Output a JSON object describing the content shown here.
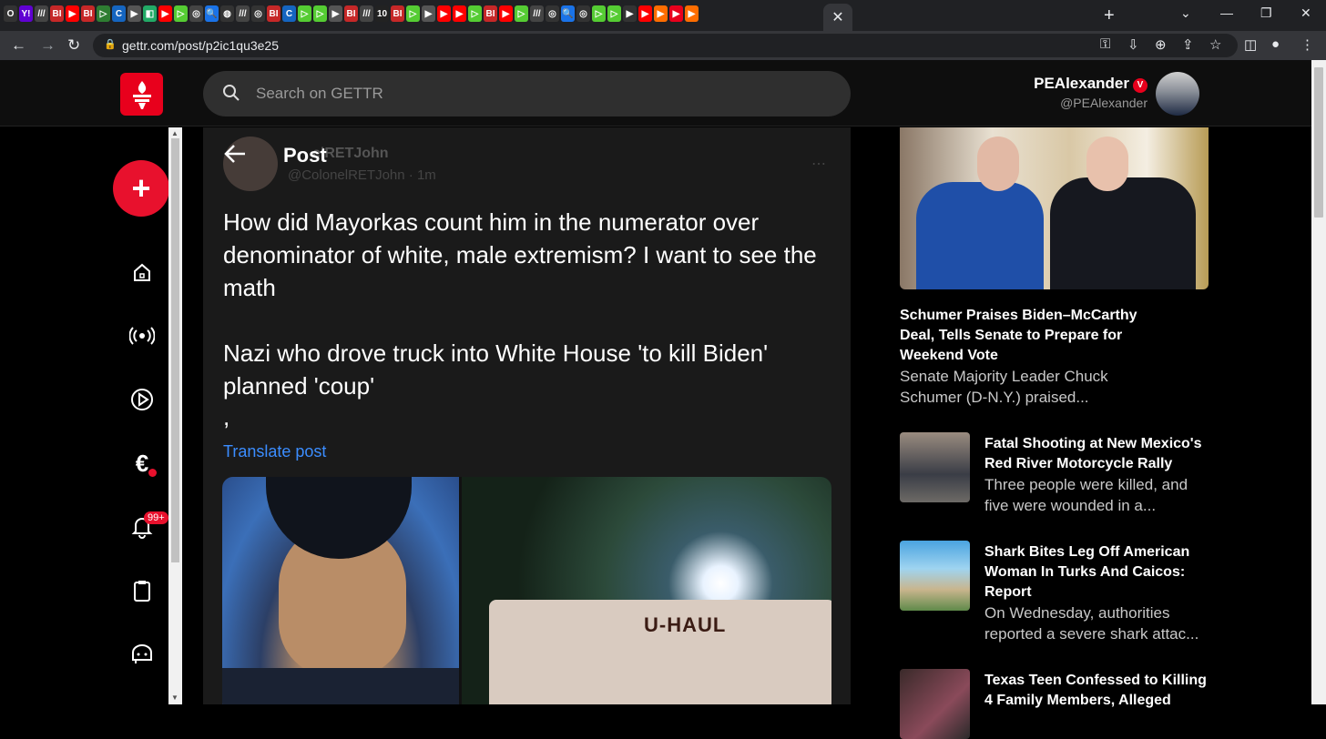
{
  "browser": {
    "url": "gettr.com/post/p2ic1qu3e25",
    "tabs": [
      "O",
      "Y!",
      "///",
      "BI",
      "▶",
      "BI",
      "▷",
      "C",
      "▶",
      "◧",
      "▶",
      "▷",
      "◎",
      "🔍",
      "◍",
      "///",
      "◎",
      "BI",
      "C",
      "▷",
      "▷",
      "▶",
      "BI",
      "///",
      "10",
      "BI",
      "▷",
      "▶",
      "▶",
      "▶",
      "▷",
      "BI",
      "▶",
      "▷",
      "///",
      "◎",
      "🔍",
      "◎",
      "▷",
      "▷",
      "▶",
      "▶",
      "▶",
      "▶",
      "▶"
    ],
    "active_tab_close": "✕",
    "new_tab": "+",
    "window_controls": [
      "⌄",
      "—",
      "❐",
      "✕"
    ]
  },
  "header": {
    "search_placeholder": "Search on GETTR",
    "user": {
      "display_name": "PEAlexander",
      "verified_badge": "V",
      "handle": "@PEAlexander"
    }
  },
  "sidebar": {
    "compose_label": "+",
    "notifications_count": "99+",
    "items": [
      {
        "name": "home",
        "icon": "house-icon"
      },
      {
        "name": "live",
        "icon": "broadcast-icon"
      },
      {
        "name": "video",
        "icon": "play-circle-icon"
      },
      {
        "name": "earnings",
        "icon": "euro-icon"
      },
      {
        "name": "notifications",
        "icon": "bell-icon"
      },
      {
        "name": "clipboard",
        "icon": "clipboard-icon"
      },
      {
        "name": "chat",
        "icon": "chat-icon"
      }
    ]
  },
  "post": {
    "page_title": "Post",
    "author_name_ghost": "elRETJohn",
    "author_handle_ghost": "@ColonelRETJohn · 1m",
    "text_paragraphs": [
      "How did Mayorkas count him in the numerator over denominator of white, male extremism?  I want to see the math",
      "Nazi who drove truck into White House 'to kill Biden' planned 'coup'",
      ","
    ],
    "translate_label": "Translate post",
    "image_text": "U-HAUL"
  },
  "news": {
    "lead": {
      "title": "Schumer Praises Biden–McCarthy Deal, Tells Senate to Prepare for Weekend Vote",
      "desc": "Senate Majority Leader Chuck Schumer (D-N.Y.) praised..."
    },
    "items": [
      {
        "title": "Fatal Shooting at New Mexico's Red River Motorcycle Rally",
        "desc": "Three people were killed, and five were wounded in a..."
      },
      {
        "title": "Shark Bites Leg Off American Woman In Turks And Caicos: Report",
        "desc": "On Wednesday, authorities reported a severe shark attac..."
      },
      {
        "title": "Texas Teen Confessed to Killing 4 Family Members, Alleged",
        "desc": ""
      }
    ]
  },
  "colors": {
    "brand": "#e8001c",
    "link": "#3b8dff",
    "background": "#000000",
    "card": "#1a1a1a"
  }
}
